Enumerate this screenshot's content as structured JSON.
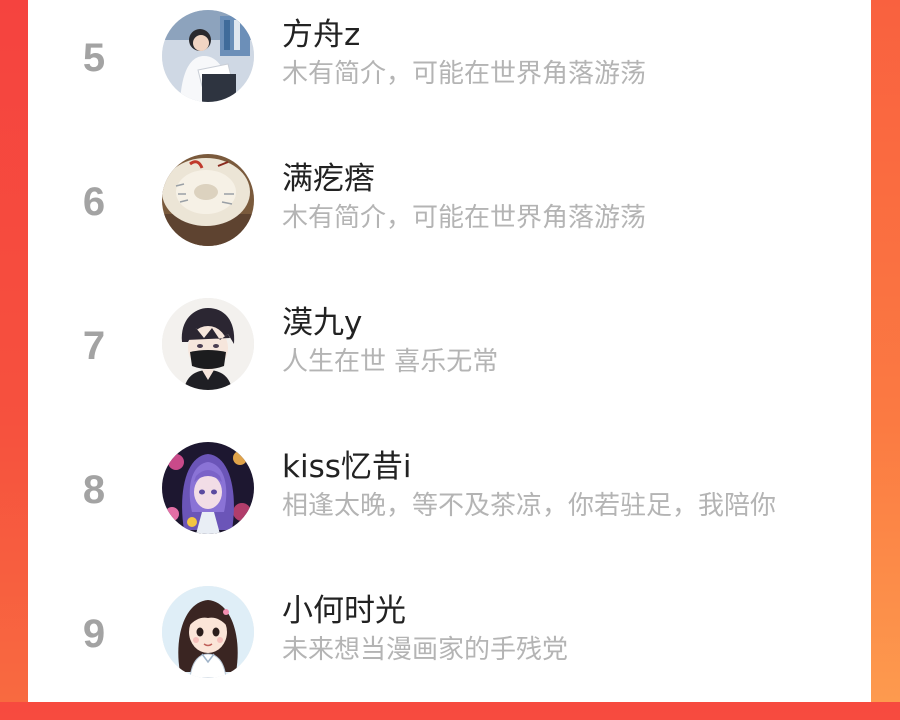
{
  "ranking": {
    "items": [
      {
        "rank": "5",
        "name": "方舟z",
        "bio": "木有简介，可能在世界角落游荡",
        "avatar": "avatar-boy-reading-image"
      },
      {
        "rank": "6",
        "name": "满疙瘩",
        "bio": "木有简介，可能在世界角落游荡",
        "avatar": "avatar-porcelain-plate-image"
      },
      {
        "rank": "7",
        "name": "漠九y",
        "bio": "人生在世 喜乐无常",
        "avatar": "avatar-masked-boy-image"
      },
      {
        "rank": "8",
        "name": "kiss忆昔i",
        "bio": "相逢太晚，等不及茶凉，你若驻足，我陪你",
        "avatar": "avatar-purple-hair-girl-image"
      },
      {
        "rank": "9",
        "name": "小何时光",
        "bio": "未来想当漫画家的手残党",
        "avatar": "avatar-cartoon-girl-image"
      }
    ]
  },
  "colors": {
    "background_red": "#f74a3f",
    "background_orange": "#fb8a44",
    "rank_number": "#a3a3a3",
    "name_text": "#222222",
    "bio_text": "#b4b4b4"
  }
}
